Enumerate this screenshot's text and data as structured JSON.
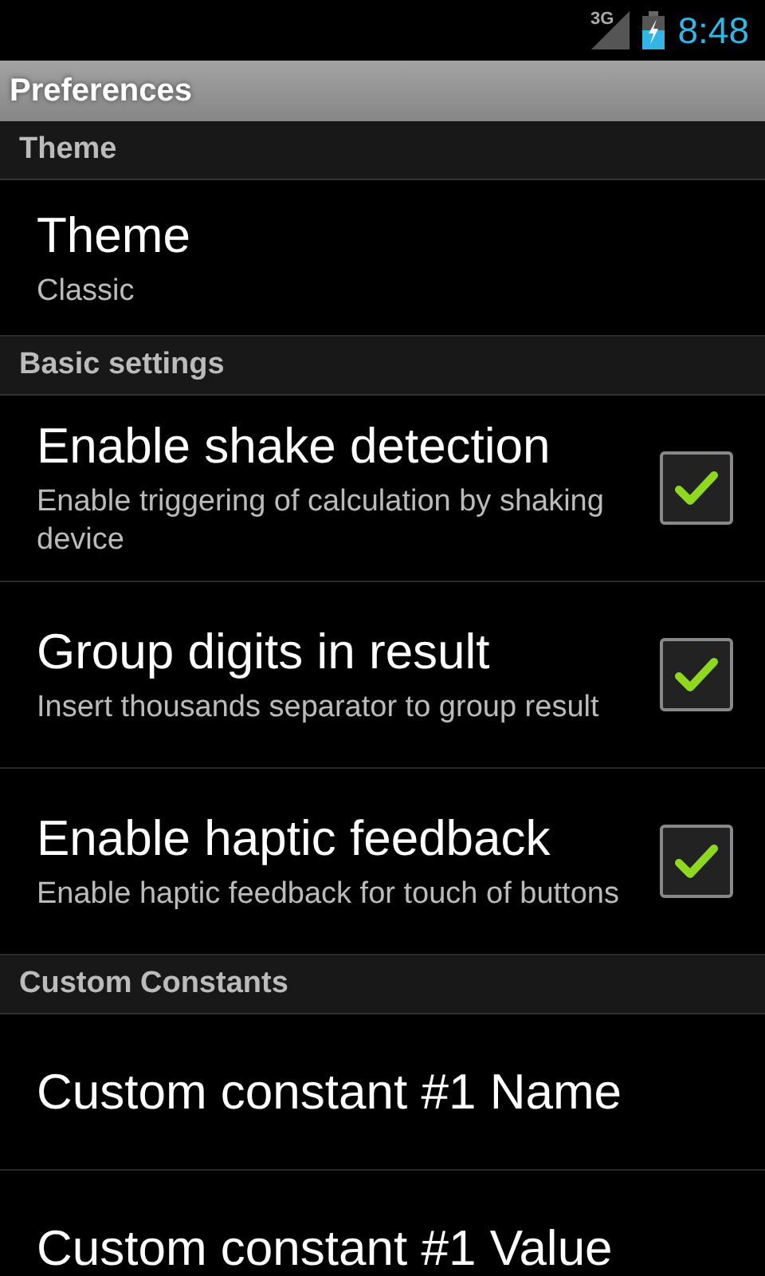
{
  "status_bar": {
    "network": "3G",
    "time": "8:48"
  },
  "window": {
    "title": "Preferences"
  },
  "sections": [
    {
      "title": "Theme",
      "items": [
        {
          "kind": "list",
          "title": "Theme",
          "summary": "Classic"
        }
      ]
    },
    {
      "title": "Basic settings",
      "items": [
        {
          "kind": "checkbox",
          "title": "Enable shake detection",
          "summary": "Enable triggering of calculation by shaking device",
          "checked": true
        },
        {
          "kind": "checkbox",
          "title": "Group digits in result",
          "summary": "Insert thousands separator to group result",
          "checked": true
        },
        {
          "kind": "checkbox",
          "title": "Enable haptic feedback",
          "summary": "Enable haptic feedback for touch of buttons",
          "checked": true
        }
      ]
    },
    {
      "title": "Custom Constants",
      "items": [
        {
          "kind": "edit",
          "title": "Custom constant #1 Name"
        },
        {
          "kind": "edit",
          "title": "Custom constant #1 Value"
        }
      ]
    }
  ]
}
